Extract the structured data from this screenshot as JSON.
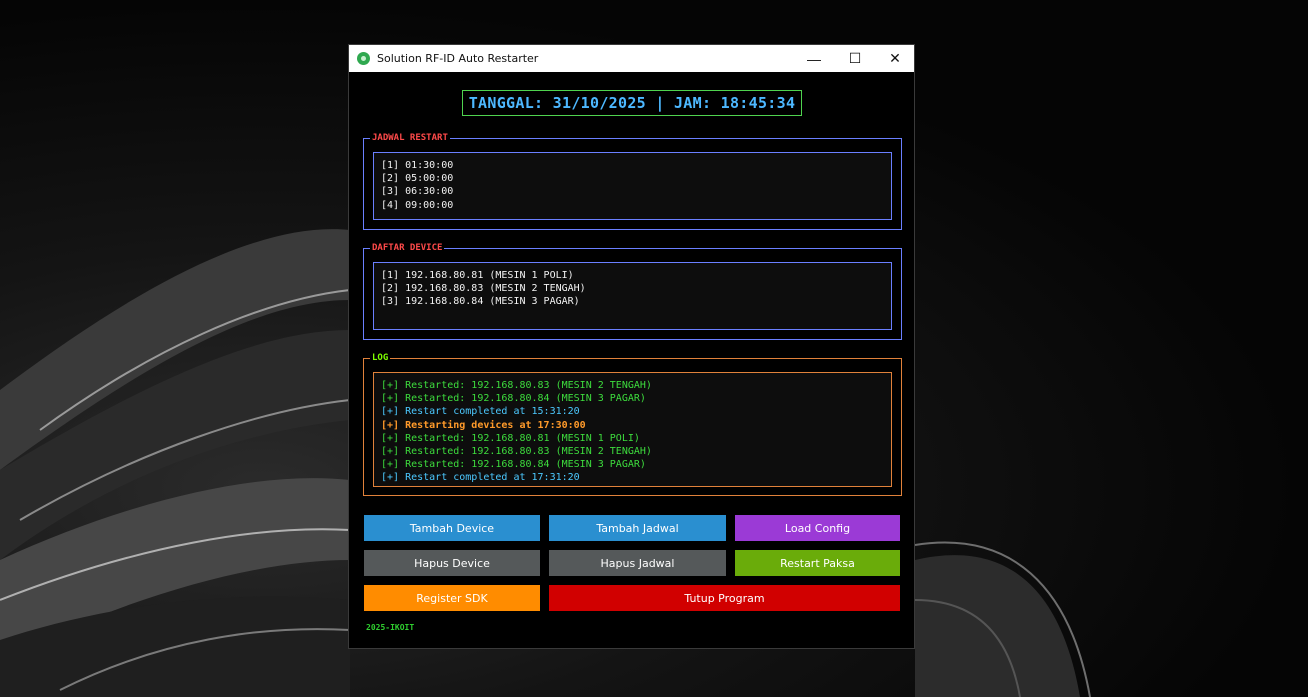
{
  "window": {
    "title": "Solution RF-ID Auto Restarter",
    "controls": {
      "minimize": "—",
      "maximize": "☐",
      "close": "✕"
    }
  },
  "clock": {
    "text": "TANGGAL: 31/10/2025 | JAM: 18:45:34",
    "color": "#4db8ff",
    "border": "#4fd34f"
  },
  "jadwal": {
    "label": "JADWAL RESTART",
    "label_color": "#ff4a4a",
    "border_color": "#6a7fff",
    "items": [
      "[1] 01:30:00",
      "[2] 05:00:00",
      "[3] 06:30:00",
      "[4] 09:00:00"
    ]
  },
  "devices": {
    "label": "DAFTAR DEVICE",
    "label_color": "#ff4a4a",
    "border_color": "#6a7fff",
    "items": [
      "[1] 192.168.80.81 (MESIN 1 POLI)",
      "[2] 192.168.80.83 (MESIN 2 TENGAH)",
      "[3] 192.168.80.84 (MESIN 3 PAGAR)"
    ]
  },
  "log": {
    "label": "LOG",
    "label_color": "#7fff00",
    "border_color": "#e0813a",
    "lines": [
      {
        "text": "[+] Restarted: 192.168.80.83 (MESIN 2 TENGAH)",
        "color": "#3ddc3d",
        "bold": false
      },
      {
        "text": "[+] Restarted: 192.168.80.84 (MESIN 3 PAGAR)",
        "color": "#3ddc3d",
        "bold": false
      },
      {
        "text": "[+] Restart completed at 15:31:20",
        "color": "#4cc9ff",
        "bold": false
      },
      {
        "text": "[+] Restarting devices at 17:30:00",
        "color": "#ff9a2a",
        "bold": true
      },
      {
        "text": "[+] Restarted: 192.168.80.81 (MESIN 1 POLI)",
        "color": "#3ddc3d",
        "bold": false
      },
      {
        "text": "[+] Restarted: 192.168.80.83 (MESIN 2 TENGAH)",
        "color": "#3ddc3d",
        "bold": false
      },
      {
        "text": "[+] Restarted: 192.168.80.84 (MESIN 3 PAGAR)",
        "color": "#3ddc3d",
        "bold": false
      },
      {
        "text": "[+] Restart completed at 17:31:20",
        "color": "#4cc9ff",
        "bold": false
      }
    ]
  },
  "buttons": {
    "tambah_device": {
      "label": "Tambah Device",
      "color": "#2a8fd0"
    },
    "tambah_jadwal": {
      "label": "Tambah Jadwal",
      "color": "#2a8fd0"
    },
    "load_config": {
      "label": "Load Config",
      "color": "#9b3ad6"
    },
    "hapus_device": {
      "label": "Hapus Device",
      "color": "#55595a"
    },
    "hapus_jadwal": {
      "label": "Hapus Jadwal",
      "color": "#55595a"
    },
    "restart_paksa": {
      "label": "Restart Paksa",
      "color": "#6aac0a"
    },
    "register_sdk": {
      "label": "Register SDK",
      "color": "#ff8c00"
    },
    "tutup_program": {
      "label": "Tutup Program",
      "color": "#d10000"
    }
  },
  "footer": {
    "text": "2025-IKOIT",
    "color": "#2fcf2f"
  }
}
